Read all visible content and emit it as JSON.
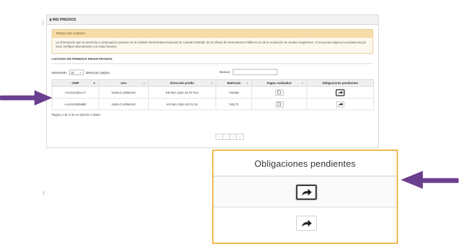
{
  "panel": {
    "title": "MIS PREDIOS",
    "notice": {
      "heading": "TENGA EN CUENTA",
      "text": "La información que se presenta a continuación proviene de la Unidad Administrativa Especial de Catastro Distrital, de la Oficina de Instrumentos Públicos y/o de la resolución de medios magnéticos. Si encuentra alguna inconsistencia por favor verifique directamente con estas fuentes."
    },
    "list_title": "LISTADO DE PREDIOS REGISTRADOS",
    "controls": {
      "show_prefix": "Mostrando",
      "page_size": "10",
      "show_suffix": "datos por página",
      "search_label": "Buscar:",
      "search_value": ""
    },
    "table": {
      "columns": [
        "CHIP",
        "Uso",
        "Dirección predio",
        "Matrícula",
        "Pagos realizados",
        "Obligaciones pendientes"
      ],
      "rows": [
        {
          "chip": "AAA0124ELUY",
          "uso": "SUELO URBANO",
          "direccion": "KR 56A 125A 40 AP 512",
          "matricula": "745395"
        },
        {
          "chip": "AAA0124EMMR",
          "uso": "SUELO URBANO",
          "direccion": "KR 56A 125A 40 GJ 15",
          "matricula": "745171"
        }
      ]
    },
    "pagination_info": "Página 1 de 2 de un total de 2 datos",
    "pager": [
      "«",
      "‹",
      "›",
      "»"
    ]
  },
  "zoom": {
    "heading": "Obligaciones pendientes"
  },
  "icons": {
    "document": "document-icon",
    "share": "share-arrow-icon",
    "pointer": "purple-arrow"
  },
  "colors": {
    "notice_bg": "#fcf8ee",
    "notice_header": "#f5dcaa",
    "callout_border": "#f2b84b",
    "arrow": "#6b3f8f"
  }
}
